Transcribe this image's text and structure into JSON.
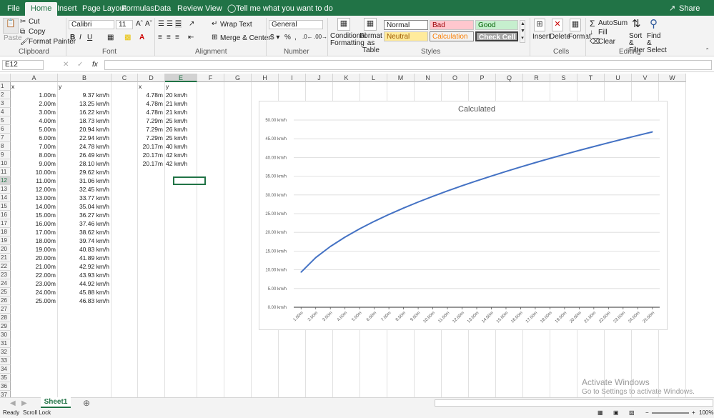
{
  "ribbon_tabs": [
    "File",
    "Home",
    "Insert",
    "Page Layout",
    "Formulas",
    "Data",
    "Review",
    "View"
  ],
  "tell_me": "Tell me what you want to do",
  "share": "Share",
  "clipboard": {
    "paste": "Paste",
    "cut": "Cut",
    "copy": "Copy",
    "painter": "Format Painter",
    "label": "Clipboard"
  },
  "font": {
    "name": "Calibri",
    "size": "11",
    "label": "Font"
  },
  "alignment": {
    "wrap": "Wrap Text",
    "merge": "Merge & Center",
    "label": "Alignment"
  },
  "number": {
    "format": "General",
    "label": "Number"
  },
  "styles": {
    "cf": "Conditional Formatting",
    "table": "Format as Table",
    "normal": "Normal",
    "bad": "Bad",
    "good": "Good",
    "neutral": "Neutral",
    "calculation": "Calculation",
    "check": "Check Cell",
    "label": "Styles"
  },
  "cells": {
    "insert": "Insert",
    "delete": "Delete",
    "format": "Format",
    "label": "Cells"
  },
  "editing": {
    "autosum": "AutoSum",
    "fill": "Fill",
    "clear": "Clear",
    "sort": "Sort & Filter",
    "find": "Find & Select",
    "label": "Editing"
  },
  "namebox": "E12",
  "fx": "fx",
  "columns": [
    "A",
    "B",
    "C",
    "D",
    "E",
    "F",
    "G",
    "H",
    "I",
    "J",
    "K",
    "L",
    "M",
    "N",
    "O",
    "P",
    "Q",
    "R",
    "S",
    "T",
    "U",
    "V",
    "W"
  ],
  "rows": [
    "1",
    "2",
    "3",
    "4",
    "5",
    "6",
    "7",
    "8",
    "9",
    "10",
    "11",
    "12",
    "13",
    "14",
    "15",
    "16",
    "17",
    "18",
    "19",
    "20",
    "21",
    "22",
    "23",
    "24",
    "25",
    "26",
    "27",
    "28",
    "29",
    "30",
    "31",
    "32",
    "33",
    "34",
    "35",
    "36",
    "37"
  ],
  "headers": {
    "a": "x",
    "b": "y",
    "d": "x",
    "e": "y"
  },
  "col_a": [
    "1.00m",
    "2.00m",
    "3.00m",
    "4.00m",
    "5.00m",
    "6.00m",
    "7.00m",
    "8.00m",
    "9.00m",
    "10.00m",
    "11.00m",
    "12.00m",
    "13.00m",
    "14.00m",
    "15.00m",
    "16.00m",
    "17.00m",
    "18.00m",
    "19.00m",
    "20.00m",
    "21.00m",
    "22.00m",
    "23.00m",
    "24.00m",
    "25.00m"
  ],
  "col_b": [
    "9.37 km/h",
    "13.25 km/h",
    "16.22 km/h",
    "18.73 km/h",
    "20.94 km/h",
    "22.94 km/h",
    "24.78 km/h",
    "26.49 km/h",
    "28.10 km/h",
    "29.62 km/h",
    "31.06 km/h",
    "32.45 km/h",
    "33.77 km/h",
    "35.04 km/h",
    "36.27 km/h",
    "37.46 km/h",
    "38.62 km/h",
    "39.74 km/h",
    "40.83 km/h",
    "41.89 km/h",
    "42.92 km/h",
    "43.93 km/h",
    "44.92 km/h",
    "45.88 km/h",
    "46.83 km/h"
  ],
  "col_d": [
    "4.78m",
    "4.78m",
    "4.78m",
    "7.29m",
    "7.29m",
    "7.29m",
    "20.17m",
    "20.17m",
    "20.17m"
  ],
  "col_e": [
    "20 km/h",
    "21 km/h",
    "21 km/h",
    "25 km/h",
    "26 km/h",
    "25 km/h",
    "40 km/h",
    "42 km/h",
    "42 km/h"
  ],
  "sheet_tab": "Sheet1",
  "status": {
    "ready": "Ready",
    "scroll": "Scroll Lock",
    "zoom": "100%"
  },
  "watermark": {
    "line1": "Activate Windows",
    "line2": "Go to Settings to activate Windows."
  },
  "chart_data": {
    "type": "line",
    "title": "Calculated",
    "categories": [
      "1.00m",
      "2.00m",
      "3.00m",
      "4.00m",
      "5.00m",
      "6.00m",
      "7.00m",
      "8.00m",
      "9.00m",
      "10.00m",
      "11.00m",
      "12.00m",
      "13.00m",
      "14.00m",
      "15.00m",
      "16.00m",
      "17.00m",
      "18.00m",
      "19.00m",
      "20.00m",
      "21.00m",
      "22.00m",
      "23.00m",
      "24.00m",
      "25.00m"
    ],
    "values": [
      9.37,
      13.25,
      16.22,
      18.73,
      20.94,
      22.94,
      24.78,
      26.49,
      28.1,
      29.62,
      31.06,
      32.45,
      33.77,
      35.04,
      36.27,
      37.46,
      38.62,
      39.74,
      40.83,
      41.89,
      42.92,
      43.93,
      44.92,
      45.88,
      46.83
    ],
    "ylim": [
      0,
      50
    ],
    "yticks": [
      "0.00 km/h",
      "5.00 km/h",
      "10.00 km/h",
      "15.00 km/h",
      "20.00 km/h",
      "25.00 km/h",
      "30.00 km/h",
      "35.00 km/h",
      "40.00 km/h",
      "45.00 km/h",
      "50.00 km/h"
    ],
    "color": "#4472c4",
    "grid": true
  }
}
